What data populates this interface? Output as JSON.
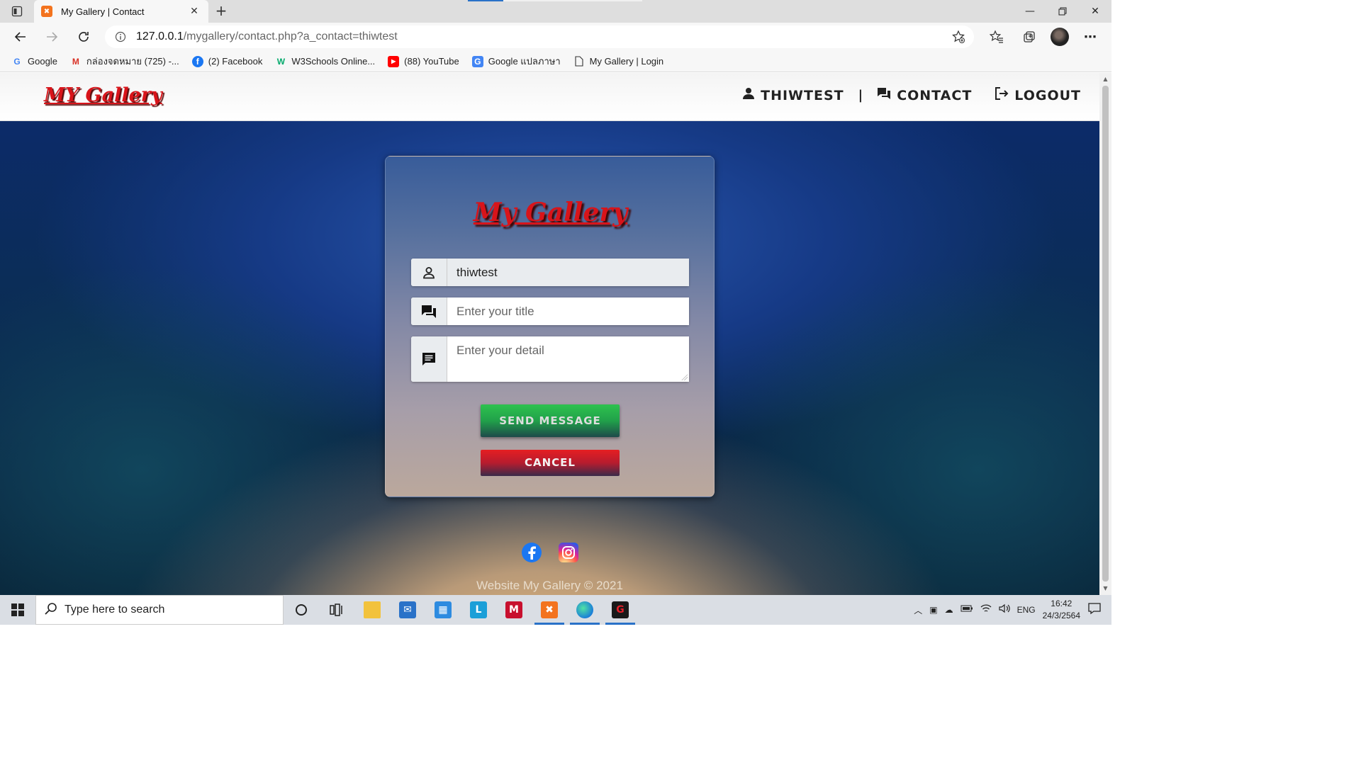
{
  "browser": {
    "tab_title": "My Gallery | Contact",
    "url_host": "127.0.0.1",
    "url_path": "/mygallery/contact.php?a_contact=thiwtest",
    "bookmarks": [
      {
        "label": "Google",
        "icon": "google-icon"
      },
      {
        "label": "กล่องจดหมาย (725) -...",
        "icon": "gmail-icon"
      },
      {
        "label": "(2) Facebook",
        "icon": "facebook-icon"
      },
      {
        "label": "W3Schools Online...",
        "icon": "w3schools-icon"
      },
      {
        "label": "(88) YouTube",
        "icon": "youtube-icon"
      },
      {
        "label": "Google แปลภาษา",
        "icon": "translate-icon"
      },
      {
        "label": "My Gallery | Login",
        "icon": "page-icon"
      }
    ]
  },
  "site": {
    "logo": "MY Gallery",
    "nav": {
      "user": "THIWTEST",
      "separator": "|",
      "contact": "CONTACT",
      "logout": "LOGOUT"
    }
  },
  "form": {
    "logo": "My Gallery",
    "username_value": "thiwtest",
    "title_placeholder": "Enter your title",
    "detail_placeholder": "Enter your detail",
    "send_label": "SEND MESSAGE",
    "cancel_label": "CANCEL"
  },
  "footer": {
    "copyright": "Website My Gallery © 2021"
  },
  "taskbar": {
    "search_placeholder": "Type here to search",
    "language": "ENG",
    "time": "16:42",
    "date": "24/3/2564"
  },
  "colors": {
    "brand_red": "#d8141a",
    "send_green": "#21a14a",
    "cancel_red": "#e51e22"
  }
}
